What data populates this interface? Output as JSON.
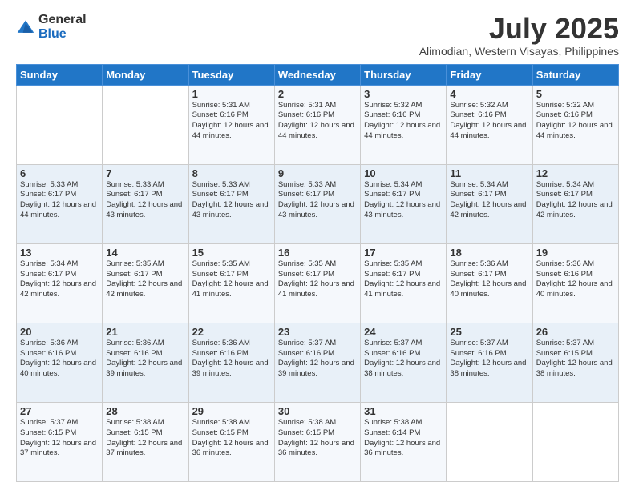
{
  "logo": {
    "general": "General",
    "blue": "Blue"
  },
  "header": {
    "title": "July 2025",
    "subtitle": "Alimodian, Western Visayas, Philippines"
  },
  "weekdays": [
    "Sunday",
    "Monday",
    "Tuesday",
    "Wednesday",
    "Thursday",
    "Friday",
    "Saturday"
  ],
  "weeks": [
    [
      {
        "day": "",
        "info": ""
      },
      {
        "day": "",
        "info": ""
      },
      {
        "day": "1",
        "info": "Sunrise: 5:31 AM\nSunset: 6:16 PM\nDaylight: 12 hours and 44 minutes."
      },
      {
        "day": "2",
        "info": "Sunrise: 5:31 AM\nSunset: 6:16 PM\nDaylight: 12 hours and 44 minutes."
      },
      {
        "day": "3",
        "info": "Sunrise: 5:32 AM\nSunset: 6:16 PM\nDaylight: 12 hours and 44 minutes."
      },
      {
        "day": "4",
        "info": "Sunrise: 5:32 AM\nSunset: 6:16 PM\nDaylight: 12 hours and 44 minutes."
      },
      {
        "day": "5",
        "info": "Sunrise: 5:32 AM\nSunset: 6:16 PM\nDaylight: 12 hours and 44 minutes."
      }
    ],
    [
      {
        "day": "6",
        "info": "Sunrise: 5:33 AM\nSunset: 6:17 PM\nDaylight: 12 hours and 44 minutes."
      },
      {
        "day": "7",
        "info": "Sunrise: 5:33 AM\nSunset: 6:17 PM\nDaylight: 12 hours and 43 minutes."
      },
      {
        "day": "8",
        "info": "Sunrise: 5:33 AM\nSunset: 6:17 PM\nDaylight: 12 hours and 43 minutes."
      },
      {
        "day": "9",
        "info": "Sunrise: 5:33 AM\nSunset: 6:17 PM\nDaylight: 12 hours and 43 minutes."
      },
      {
        "day": "10",
        "info": "Sunrise: 5:34 AM\nSunset: 6:17 PM\nDaylight: 12 hours and 43 minutes."
      },
      {
        "day": "11",
        "info": "Sunrise: 5:34 AM\nSunset: 6:17 PM\nDaylight: 12 hours and 42 minutes."
      },
      {
        "day": "12",
        "info": "Sunrise: 5:34 AM\nSunset: 6:17 PM\nDaylight: 12 hours and 42 minutes."
      }
    ],
    [
      {
        "day": "13",
        "info": "Sunrise: 5:34 AM\nSunset: 6:17 PM\nDaylight: 12 hours and 42 minutes."
      },
      {
        "day": "14",
        "info": "Sunrise: 5:35 AM\nSunset: 6:17 PM\nDaylight: 12 hours and 42 minutes."
      },
      {
        "day": "15",
        "info": "Sunrise: 5:35 AM\nSunset: 6:17 PM\nDaylight: 12 hours and 41 minutes."
      },
      {
        "day": "16",
        "info": "Sunrise: 5:35 AM\nSunset: 6:17 PM\nDaylight: 12 hours and 41 minutes."
      },
      {
        "day": "17",
        "info": "Sunrise: 5:35 AM\nSunset: 6:17 PM\nDaylight: 12 hours and 41 minutes."
      },
      {
        "day": "18",
        "info": "Sunrise: 5:36 AM\nSunset: 6:17 PM\nDaylight: 12 hours and 40 minutes."
      },
      {
        "day": "19",
        "info": "Sunrise: 5:36 AM\nSunset: 6:16 PM\nDaylight: 12 hours and 40 minutes."
      }
    ],
    [
      {
        "day": "20",
        "info": "Sunrise: 5:36 AM\nSunset: 6:16 PM\nDaylight: 12 hours and 40 minutes."
      },
      {
        "day": "21",
        "info": "Sunrise: 5:36 AM\nSunset: 6:16 PM\nDaylight: 12 hours and 39 minutes."
      },
      {
        "day": "22",
        "info": "Sunrise: 5:36 AM\nSunset: 6:16 PM\nDaylight: 12 hours and 39 minutes."
      },
      {
        "day": "23",
        "info": "Sunrise: 5:37 AM\nSunset: 6:16 PM\nDaylight: 12 hours and 39 minutes."
      },
      {
        "day": "24",
        "info": "Sunrise: 5:37 AM\nSunset: 6:16 PM\nDaylight: 12 hours and 38 minutes."
      },
      {
        "day": "25",
        "info": "Sunrise: 5:37 AM\nSunset: 6:16 PM\nDaylight: 12 hours and 38 minutes."
      },
      {
        "day": "26",
        "info": "Sunrise: 5:37 AM\nSunset: 6:15 PM\nDaylight: 12 hours and 38 minutes."
      }
    ],
    [
      {
        "day": "27",
        "info": "Sunrise: 5:37 AM\nSunset: 6:15 PM\nDaylight: 12 hours and 37 minutes."
      },
      {
        "day": "28",
        "info": "Sunrise: 5:38 AM\nSunset: 6:15 PM\nDaylight: 12 hours and 37 minutes."
      },
      {
        "day": "29",
        "info": "Sunrise: 5:38 AM\nSunset: 6:15 PM\nDaylight: 12 hours and 36 minutes."
      },
      {
        "day": "30",
        "info": "Sunrise: 5:38 AM\nSunset: 6:15 PM\nDaylight: 12 hours and 36 minutes."
      },
      {
        "day": "31",
        "info": "Sunrise: 5:38 AM\nSunset: 6:14 PM\nDaylight: 12 hours and 36 minutes."
      },
      {
        "day": "",
        "info": ""
      },
      {
        "day": "",
        "info": ""
      }
    ]
  ]
}
